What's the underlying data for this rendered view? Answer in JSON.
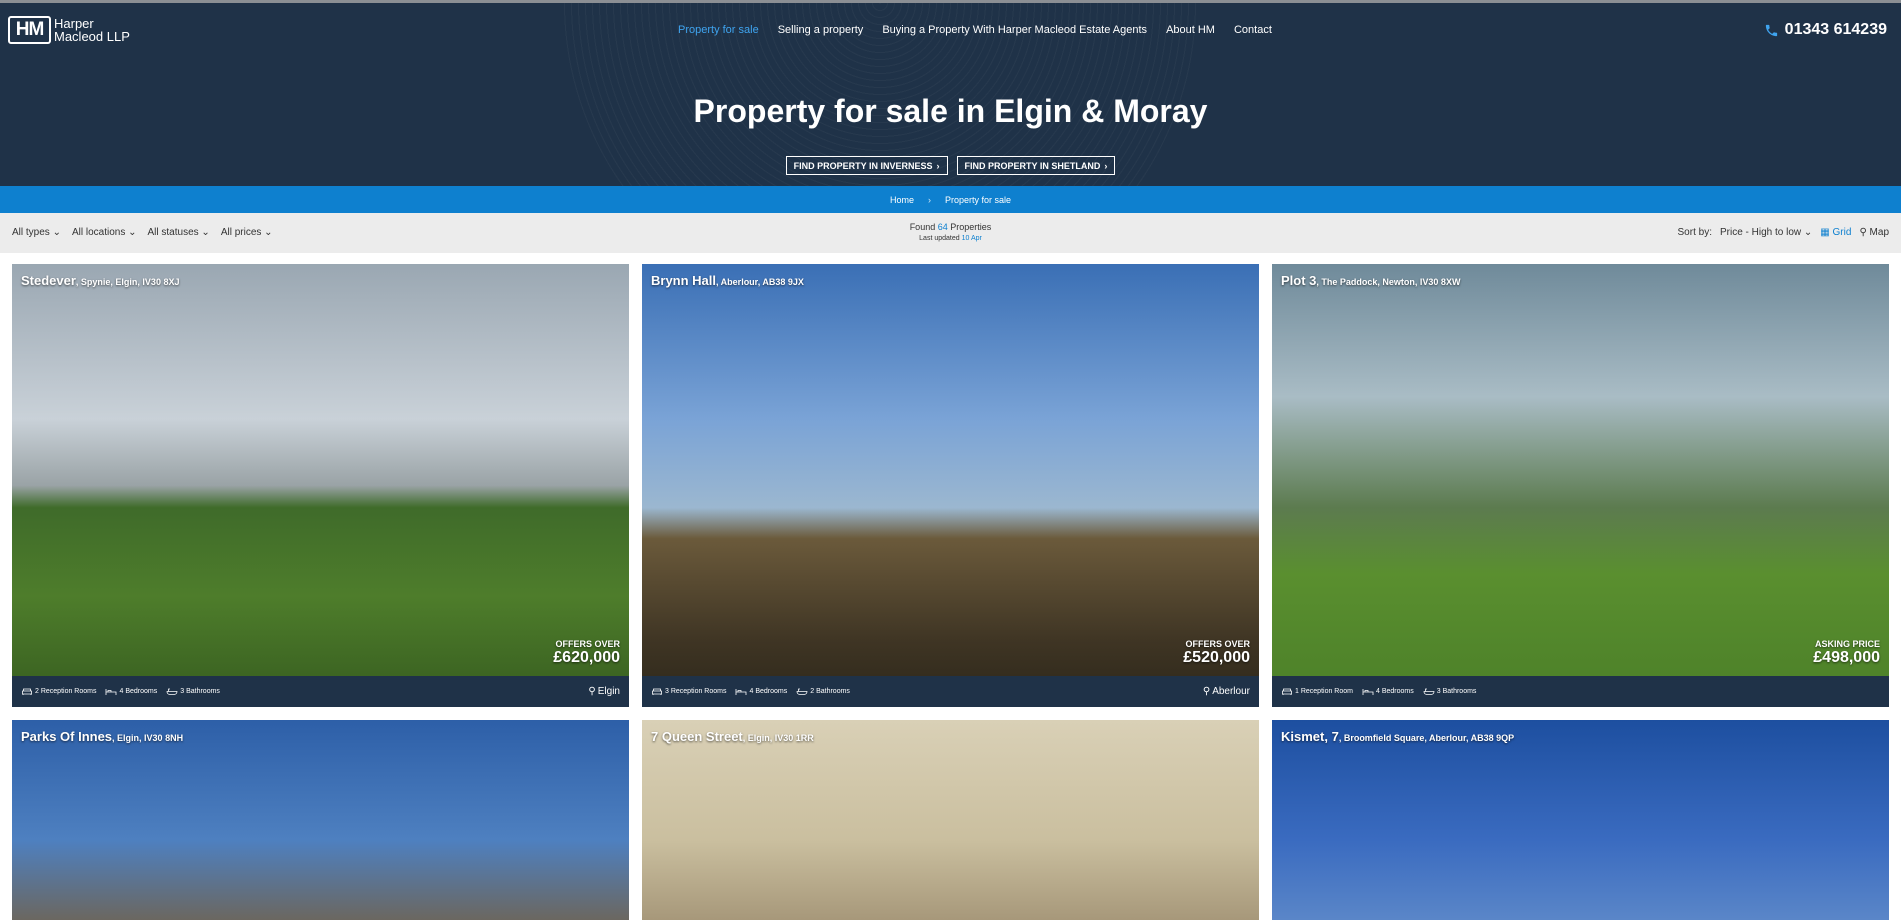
{
  "brand": {
    "logo_mark": "HM",
    "name_line1": "Harper",
    "name_line2": "Macleod LLP",
    "phone": "01343 614239"
  },
  "nav": [
    "Property for sale",
    "Selling a property",
    "Buying a Property With Harper Macleod Estate Agents",
    "About HM",
    "Contact"
  ],
  "hero": {
    "title": "Property for sale in Elgin & Moray",
    "btn_inverness": "FIND PROPERTY IN INVERNESS",
    "btn_shetland": "FIND PROPERTY IN SHETLAND"
  },
  "breadcrumb": {
    "home": "Home",
    "current": "Property for sale"
  },
  "filters": {
    "types": "All types",
    "locations": "All locations",
    "statuses": "All statuses",
    "prices": "All prices"
  },
  "results": {
    "found_prefix": "Found",
    "count": "64",
    "found_suffix": "Properties",
    "updated_prefix": "Last updated",
    "updated_date": "10 Apr"
  },
  "sort": {
    "label": "Sort by:",
    "value": "Price - High to low",
    "grid": "Grid",
    "map": "Map"
  },
  "listings": [
    {
      "name": "Stedever",
      "address": ", Spynie, Elgin, IV30 8XJ",
      "price_label": "OFFERS OVER",
      "price": "£620,000",
      "reception": "2 Reception Rooms",
      "bedrooms": "4 Bedrooms",
      "bathrooms": "3 Bathrooms",
      "location": "Elgin"
    },
    {
      "name": "Brynn Hall",
      "address": ", Aberlour, AB38 9JX",
      "price_label": "OFFERS OVER",
      "price": "£520,000",
      "reception": "3 Reception Rooms",
      "bedrooms": "4 Bedrooms",
      "bathrooms": "2 Bathrooms",
      "location": "Aberlour"
    },
    {
      "name": "Plot 3",
      "address": ", The Paddock, Newton, IV30 8XW",
      "price_label": "ASKING PRICE",
      "price": "£498,000",
      "reception": "1 Reception Room",
      "bedrooms": "4 Bedrooms",
      "bathrooms": "3 Bathrooms",
      "location": ""
    },
    {
      "name": "Parks Of Innes",
      "address": ", Elgin, IV30 8NH"
    },
    {
      "name": "7 Queen Street",
      "address": ", Elgin, IV30 1RR"
    },
    {
      "name": "Kismet, 7",
      "address": ", Broomfield Square, Aberlour, AB38 9QP"
    }
  ]
}
